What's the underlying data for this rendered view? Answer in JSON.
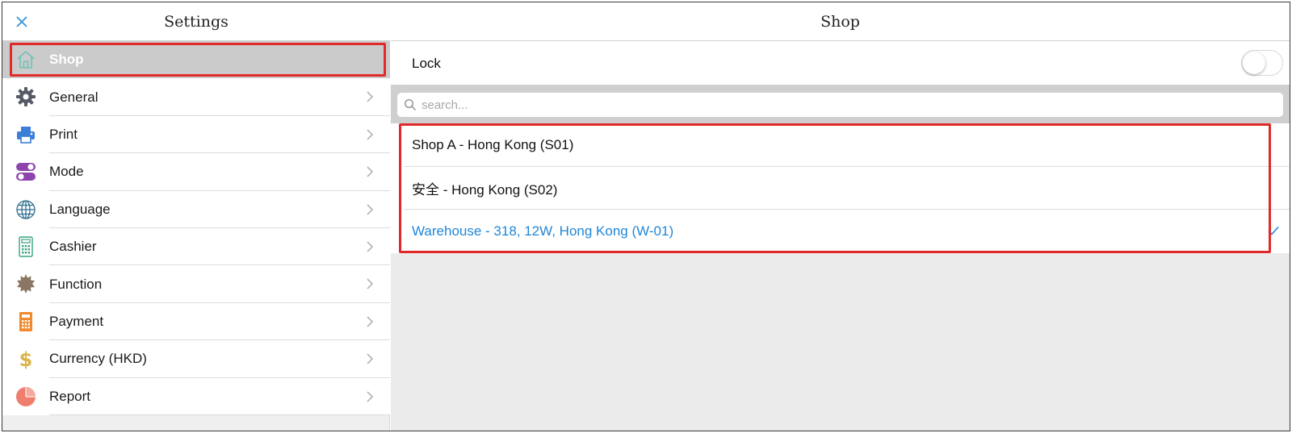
{
  "sidebar": {
    "title": "Settings",
    "close_icon": "close-icon",
    "items": [
      {
        "label": "Shop",
        "icon": "home-icon",
        "selected": true
      },
      {
        "label": "General",
        "icon": "gear-icon"
      },
      {
        "label": "Print",
        "icon": "printer-icon"
      },
      {
        "label": "Mode",
        "icon": "toggle-switches-icon"
      },
      {
        "label": "Language",
        "icon": "globe-icon"
      },
      {
        "label": "Cashier",
        "icon": "calculator-icon"
      },
      {
        "label": "Function",
        "icon": "badge-icon"
      },
      {
        "label": "Payment",
        "icon": "payment-calculator-icon"
      },
      {
        "label": "Currency (HKD)",
        "icon": "dollar-icon"
      },
      {
        "label": "Report",
        "icon": "pie-chart-icon"
      }
    ]
  },
  "main": {
    "title": "Shop",
    "lock": {
      "label": "Lock",
      "enabled": false
    },
    "search": {
      "placeholder": "search..."
    },
    "shops": [
      {
        "label": "Shop A - Hong Kong (S01)",
        "selected": false
      },
      {
        "label": "安全 - Hong Kong (S02)",
        "selected": false
      },
      {
        "label": "Warehouse - 318, 12W, Hong Kong (W-01)",
        "selected": true
      }
    ]
  },
  "colors": {
    "accent": "#1f86d8",
    "highlight": "#e02a2a",
    "selected_bg": "#cbcbcb"
  }
}
